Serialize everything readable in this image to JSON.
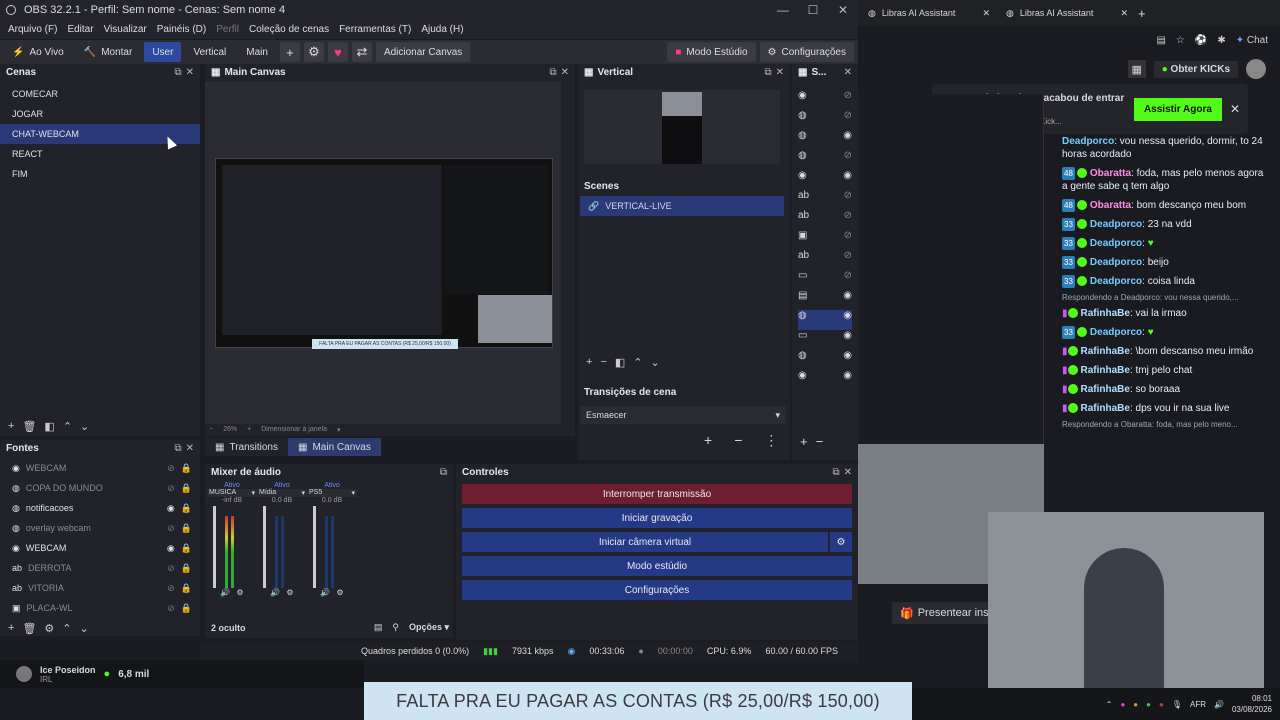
{
  "obs": {
    "window_title": "OBS 32.2.1 - Perfil: Sem nome - Cenas: Sem nome 4",
    "menu": [
      "Arquivo (F)",
      "Editar",
      "Visualizar",
      "Painéis (D)",
      "Perfil",
      "Coleção de cenas",
      "Ferramentas (T)",
      "Ajuda (H)"
    ],
    "toolbar": {
      "ao_vivo": "Ao Vivo",
      "montar": "Montar",
      "user": "User",
      "vertical": "Vertical",
      "main": "Main",
      "add_canvas": "Adicionar Canvas",
      "studio_mode": "Modo Estúdio",
      "settings": "Configurações"
    },
    "scenes": {
      "title": "Cenas",
      "items": [
        "COMECAR",
        "JOGAR",
        "CHAT-WEBCAM",
        "REACT",
        "FIM"
      ],
      "selected_index": 2
    },
    "main_canvas": {
      "title": "Main Canvas",
      "zoom": "26%",
      "resize_label": "Dimensionar à janela",
      "preview_banner": "FALTA PRA EU PAGAR AS CONTAS (R$ 25,00/R$ 150,00)"
    },
    "vertical": {
      "title": "Vertical",
      "scenes_title": "Scenes",
      "scene_item": "VERTICAL-LIVE",
      "transitions_title": "Transições de cena",
      "transition_value": "Esmaecer"
    },
    "sources_panel_short": "S...",
    "canvas_tabs": [
      "Transitions",
      "Main Canvas"
    ],
    "sources": {
      "title": "Fontes",
      "items": [
        {
          "name": "WEBCAM",
          "visible": false
        },
        {
          "name": "COPA DO MUNDO",
          "visible": false
        },
        {
          "name": "notificacoes",
          "visible": true
        },
        {
          "name": "overlay webcam",
          "visible": false
        },
        {
          "name": "WEBCAM",
          "visible": true
        },
        {
          "name": "DERROTA",
          "visible": false
        },
        {
          "name": "VITORIA",
          "visible": false
        },
        {
          "name": "PLACA-WL",
          "visible": false
        }
      ]
    },
    "mixer": {
      "title": "Mixer de áudio",
      "hidden_count": "2 oculto",
      "options": "Opções",
      "channels": [
        {
          "state": "Ativo",
          "name": "MUSICA",
          "db": "-inf dB"
        },
        {
          "state": "Ativo",
          "name": "Mídia",
          "db": "0.0 dB"
        },
        {
          "state": "Ativo",
          "name": "PS5",
          "db": "0.0 dB"
        }
      ],
      "scale": [
        "0",
        "-6",
        "-12",
        "-18",
        "-24",
        "-30",
        "-36",
        "-42",
        "-48",
        "-54",
        "-60"
      ]
    },
    "controls": {
      "title": "Controles",
      "stop_stream": "Interromper transmissão",
      "start_record": "Iniciar gravação",
      "virtual_cam": "Iniciar câmera virtual",
      "studio_mode": "Modo estúdio",
      "settings": "Configurações"
    },
    "status": {
      "dropped": "Quadros perdidos 0 (0.0%)",
      "bitrate": "7931 kbps",
      "stream_time": "00:33:06",
      "rec_time": "00:00:00",
      "cpu": "CPU: 6.9%",
      "fps": "60.00 / 60.00 FPS"
    },
    "profile": {
      "name": "Ice Poseidon",
      "sub": "IRL",
      "followers": "6,8 mil"
    }
  },
  "browser": {
    "tabs": [
      "Libras AI Assistant",
      "Libras AI Assistant"
    ],
    "chat_label": "Chat",
    "kick_button": "Obter KICKs",
    "notification": {
      "title": "GuiMirandaDS acabou de entrar ao vivo!",
      "sub": "Apenas Melhorar - Kick...",
      "button": "Assistir Agora"
    },
    "chat": [
      {
        "badge": "",
        "nick": "Deadporco",
        "text": "vou nessa querido, dormir, to 24 horas acordado",
        "style": "nick3"
      },
      {
        "badge": "48",
        "nick": "Obaratta",
        "text": "foda, mas pelo menos agora a gente sabe q tem algo",
        "style": "nick2"
      },
      {
        "badge": "48",
        "nick": "Obaratta",
        "text": "bom descanço meu bom",
        "style": "nick2"
      },
      {
        "badge": "33",
        "nick": "Deadporco",
        "text": "23 na vdd",
        "style": "nick3"
      },
      {
        "badge": "33",
        "nick": "Deadporco",
        "text": "♥",
        "style": "nick3"
      },
      {
        "badge": "33",
        "nick": "Deadporco",
        "text": "beijo",
        "style": "nick3"
      },
      {
        "badge": "33",
        "nick": "Deadporco",
        "text": "coisa linda",
        "style": "nick3"
      },
      {
        "badge": "",
        "nick": "RafinhaBe",
        "text": "vai la irmao",
        "style": "nick1"
      },
      {
        "badge": "33",
        "nick": "Deadporco",
        "text": "♥",
        "style": "nick3"
      },
      {
        "badge": "",
        "nick": "RafinhaBe",
        "text": "\\bom descanso meu irmão",
        "style": "nick1"
      },
      {
        "badge": "",
        "nick": "RafinhaBe",
        "text": "tmj pelo chat",
        "style": "nick1"
      },
      {
        "badge": "",
        "nick": "RafinhaBe",
        "text": "so boraaa",
        "style": "nick1"
      },
      {
        "badge": "",
        "nick": "RafinhaBe",
        "text": "dps vou ir na sua live",
        "style": "nick1"
      }
    ],
    "reply_1": "Respondendo a Deadporco: vou nessa querido,...",
    "reply_2": "Respondendo a Obaratta: foda, mas pelo meno...",
    "present_button": "Presentear ins"
  },
  "stream_banner": "FALTA PRA EU PAGAR AS CONTAS (R$ 25,00/R$ 150,00)",
  "taskbar": {
    "time": "08:01",
    "date": "03/08/2026",
    "lang": "AFR"
  }
}
